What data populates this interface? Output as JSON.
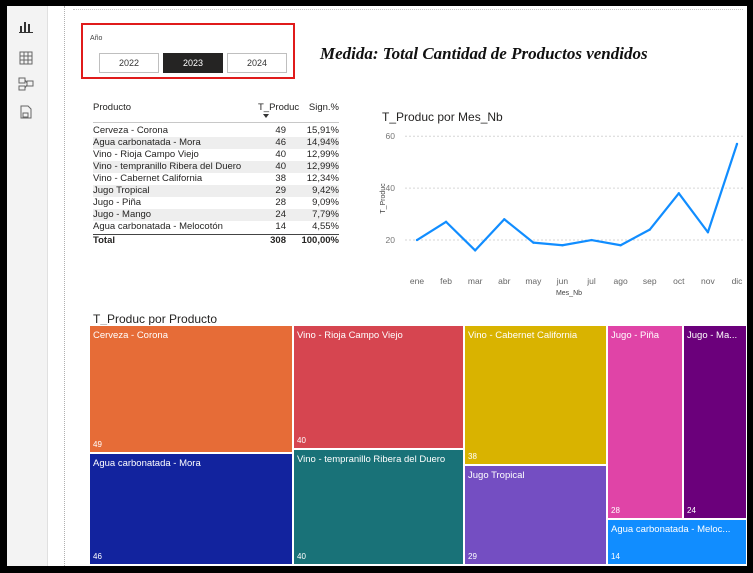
{
  "sidebar": {
    "items": [
      {
        "name": "report-view",
        "icon": "bar-chart-icon",
        "active": true
      },
      {
        "name": "table-view",
        "icon": "table-grid-icon",
        "active": false
      },
      {
        "name": "model-view",
        "icon": "model-icon",
        "active": false
      },
      {
        "name": "dax-query-view",
        "icon": "query-icon",
        "active": false
      }
    ]
  },
  "slicer": {
    "title": "Año",
    "options": [
      "2022",
      "2023",
      "2024"
    ],
    "selected": "2023"
  },
  "measure_title": "Medida: Total Cantidad de Productos vendidos",
  "table": {
    "headers": {
      "product": "Producto",
      "total": "T_Produc",
      "share": "Sign.%"
    },
    "rows": [
      {
        "product": "Cerveza - Corona",
        "total": "49",
        "share": "15,91%"
      },
      {
        "product": "Agua carbonatada - Mora",
        "total": "46",
        "share": "14,94%"
      },
      {
        "product": "Vino - Rioja Campo Viejo",
        "total": "40",
        "share": "12,99%"
      },
      {
        "product": "Vino - tempranillo Ribera del Duero",
        "total": "40",
        "share": "12,99%"
      },
      {
        "product": "Vino - Cabernet California",
        "total": "38",
        "share": "12,34%"
      },
      {
        "product": "Jugo Tropical",
        "total": "29",
        "share": "9,42%"
      },
      {
        "product": "Jugo - Piña",
        "total": "28",
        "share": "9,09%"
      },
      {
        "product": "Jugo - Mango",
        "total": "24",
        "share": "7,79%"
      },
      {
        "product": "Agua carbonatada - Melocotón",
        "total": "14",
        "share": "4,55%"
      }
    ],
    "footer": {
      "label": "Total",
      "total": "308",
      "share": "100,00%"
    }
  },
  "line_chart": {
    "title": "T_Produc por Mes_Nb",
    "xlabel": "Mes_Nb",
    "ylabel": "T_Produc",
    "color": "#118dff"
  },
  "treemap": {
    "title": "T_Produc por Producto",
    "tiles": [
      {
        "label": "Cerveza - Corona",
        "value": "49",
        "color": "#e66c37"
      },
      {
        "label": "Agua carbonatada - Mora",
        "value": "46",
        "color": "#12239e"
      },
      {
        "label": "Vino - Rioja Campo Viejo",
        "value": "40",
        "color": "#d64550"
      },
      {
        "label": "Vino - tempranillo Ribera del Duero",
        "value": "40",
        "color": "#197278"
      },
      {
        "label": "Vino - Cabernet California",
        "value": "38",
        "color": "#d9b300"
      },
      {
        "label": "Jugo Tropical",
        "value": "29",
        "color": "#744ec2"
      },
      {
        "label": "Jugo - Piña",
        "value": "28",
        "color": "#e044a7"
      },
      {
        "label": "Jugo - Ma...",
        "value": "24",
        "color": "#6b007b"
      },
      {
        "label": "Agua carbonatada - Meloc...",
        "value": "14",
        "color": "#118dff"
      }
    ]
  },
  "chart_data": {
    "type": "line",
    "title": "T_Produc por Mes_Nb",
    "xlabel": "Mes_Nb",
    "ylabel": "T_Produc",
    "x": [
      "ene",
      "feb",
      "mar",
      "abr",
      "may",
      "jun",
      "jul",
      "ago",
      "sep",
      "oct",
      "nov",
      "dic"
    ],
    "series": [
      {
        "values": [
          20,
          27,
          16,
          28,
          19,
          18,
          20,
          18,
          24,
          38,
          23,
          57
        ]
      }
    ],
    "yticks": [
      20,
      40,
      60
    ],
    "ylim": [
      10,
      62
    ],
    "grid": true
  }
}
